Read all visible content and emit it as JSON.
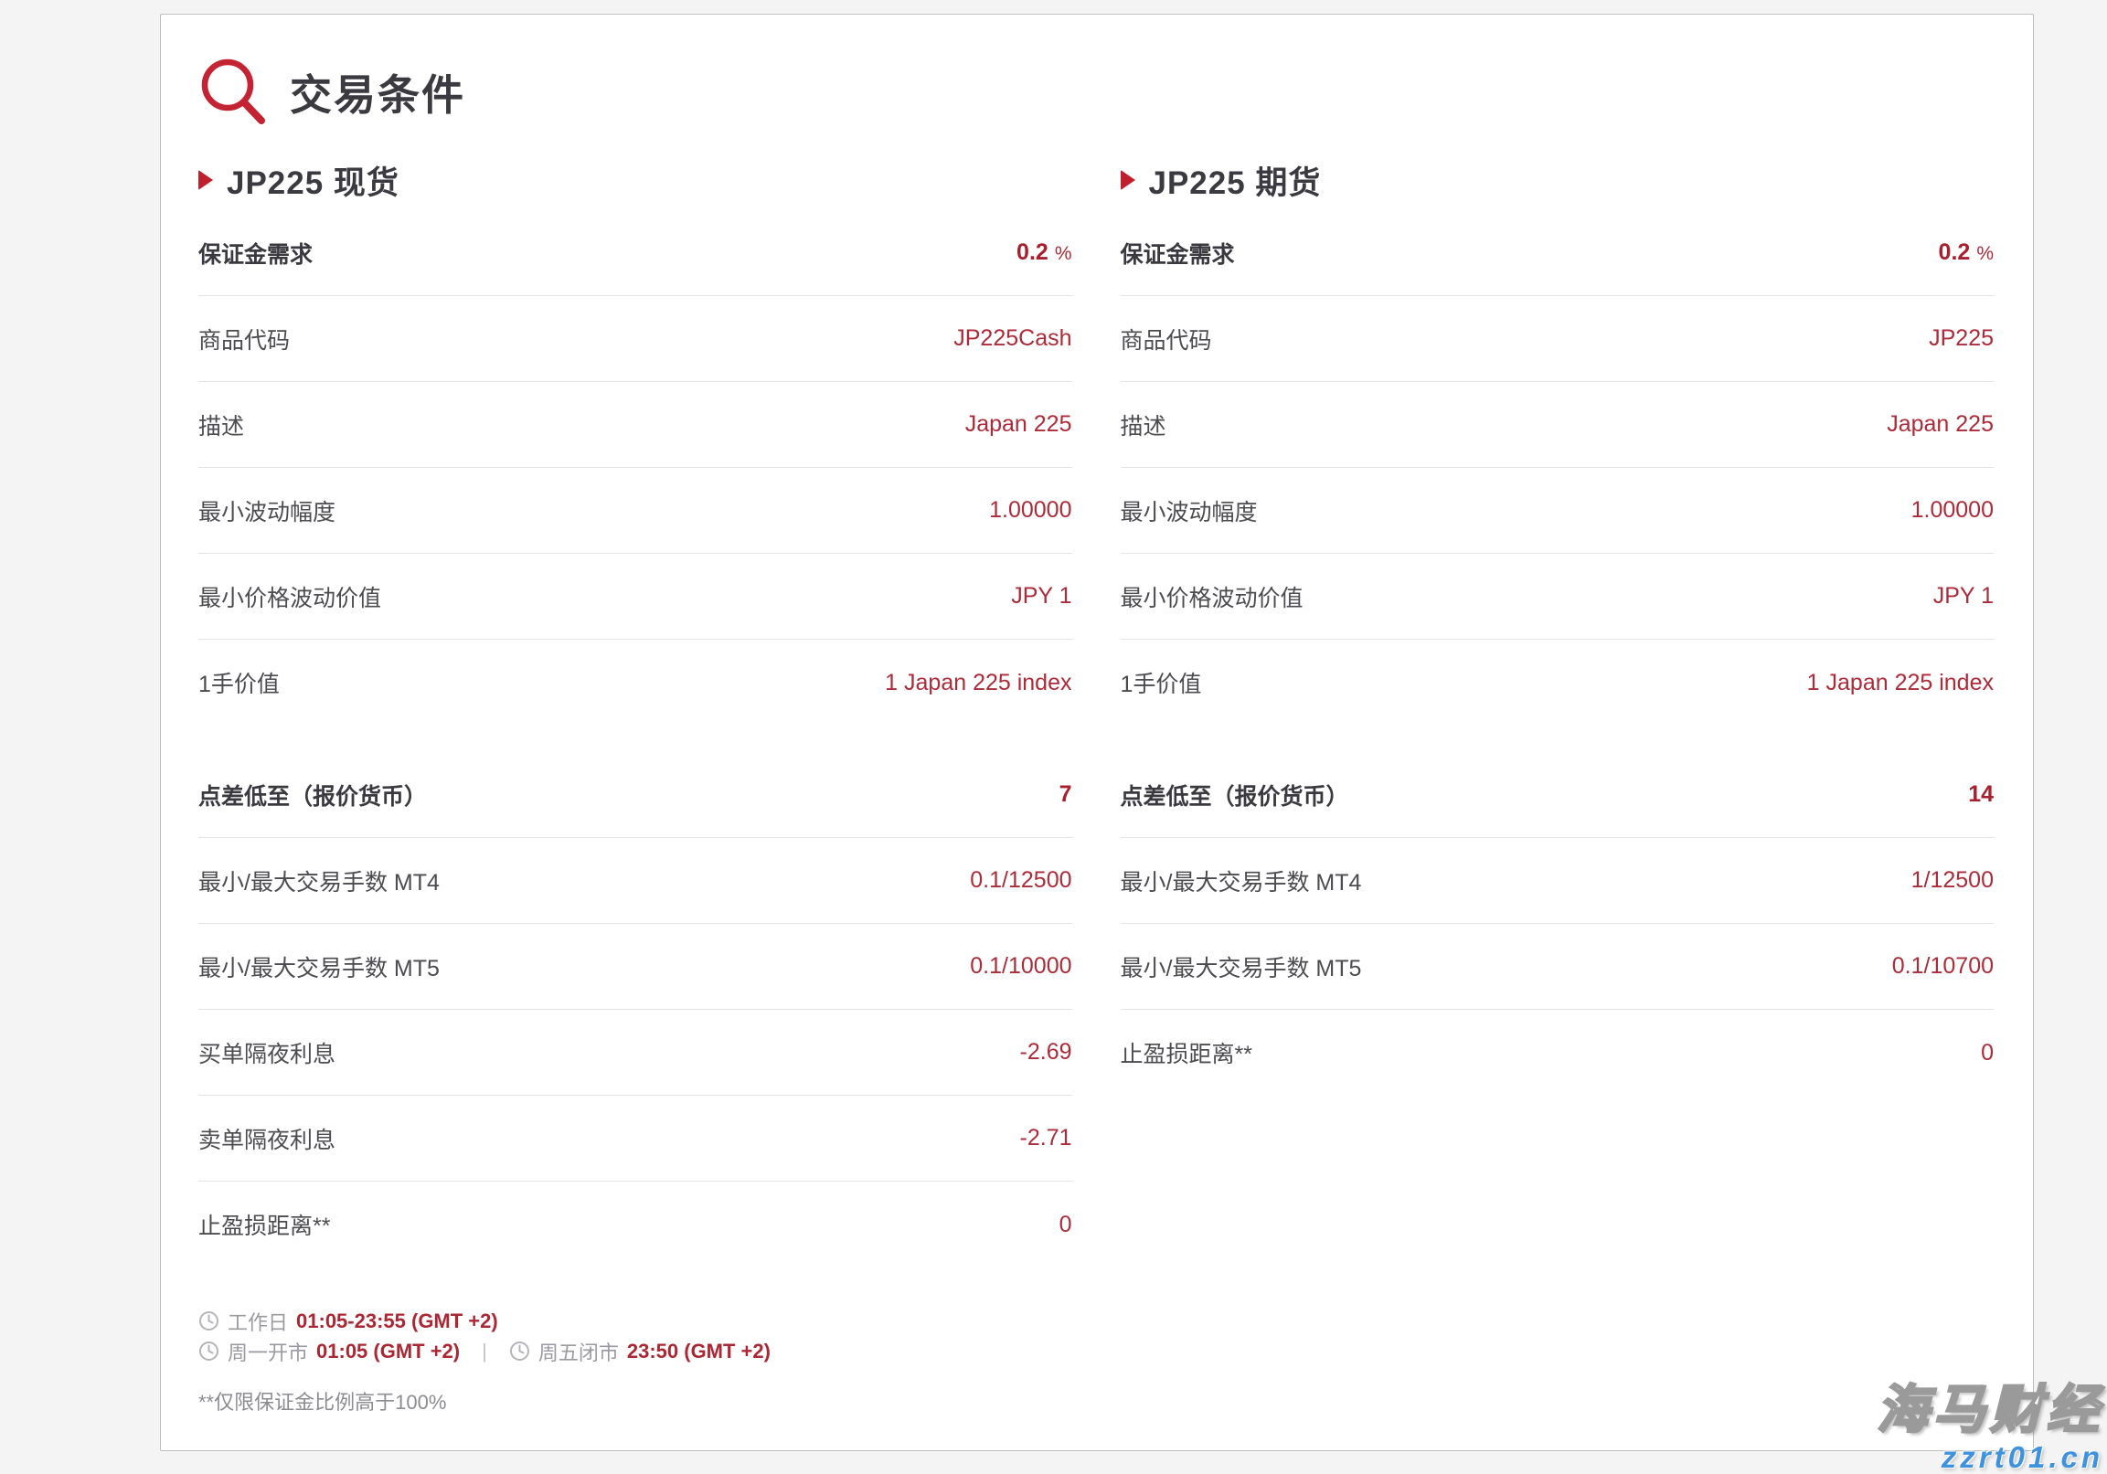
{
  "page": {
    "title": "交易条件",
    "footnote": "**仅限保证金比例高于100%"
  },
  "schedule": {
    "workday_label": "工作日",
    "workday_time": "01:05-23:55 (GMT +2)",
    "monday_open_label": "周一开市",
    "monday_open_time": "01:05 (GMT +2)",
    "separator": "|",
    "friday_close_label": "周五闭市",
    "friday_close_time": "23:50 (GMT +2)"
  },
  "tables": [
    {
      "title": "JP225 现货",
      "groups": [
        {
          "rows": [
            {
              "label": "保证金需求",
              "value": "0.2",
              "unit": "%"
            },
            {
              "label": "商品代码",
              "value": "JP225Cash"
            },
            {
              "label": "描述",
              "value": "Japan 225"
            },
            {
              "label": "最小波动幅度",
              "value": "1.00000"
            },
            {
              "label": "最小价格波动价值",
              "value": "JPY 1"
            },
            {
              "label": "1手价值",
              "value": "1 Japan 225 index"
            }
          ]
        },
        {
          "rows": [
            {
              "label": "点差低至（报价货币）",
              "value": "7"
            },
            {
              "label": "最小/最大交易手数 MT4",
              "value": "0.1/12500"
            },
            {
              "label": "最小/最大交易手数 MT5",
              "value": "0.1/10000"
            },
            {
              "label": "买单隔夜利息",
              "value": "-2.69"
            },
            {
              "label": "卖单隔夜利息",
              "value": "-2.71"
            },
            {
              "label": "止盈损距离**",
              "value": "0"
            }
          ]
        }
      ]
    },
    {
      "title": "JP225 期货",
      "groups": [
        {
          "rows": [
            {
              "label": "保证金需求",
              "value": "0.2",
              "unit": "%"
            },
            {
              "label": "商品代码",
              "value": "JP225"
            },
            {
              "label": "描述",
              "value": "Japan 225"
            },
            {
              "label": "最小波动幅度",
              "value": "1.00000"
            },
            {
              "label": "最小价格波动价值",
              "value": "JPY 1"
            },
            {
              "label": "1手价值",
              "value": "1 Japan 225 index"
            }
          ]
        },
        {
          "rows": [
            {
              "label": "点差低至（报价货币）",
              "value": "14"
            },
            {
              "label": "最小/最大交易手数 MT4",
              "value": "1/12500"
            },
            {
              "label": "最小/最大交易手数 MT5",
              "value": "0.1/10700"
            },
            {
              "label": "止盈损距离**",
              "value": "0"
            }
          ]
        }
      ]
    }
  ],
  "watermark": {
    "brand": "海马财经",
    "url": "zzrt01.cn"
  },
  "colors": {
    "accent_red": "#b32633",
    "icon_red": "#c32332",
    "heading_gray": "#3a3a40",
    "label_gray": "#4b4b50",
    "divider": "#e3e3e3",
    "watermark_blue": "#3f92dd"
  }
}
